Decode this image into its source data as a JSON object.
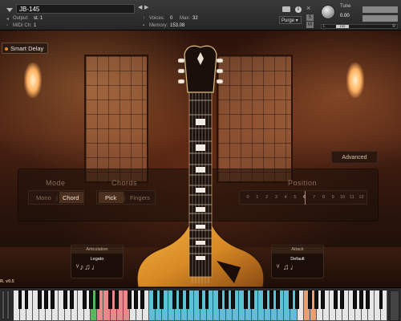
{
  "header": {
    "instrument_name": "JB-145",
    "output_label": "Output:",
    "output_value": "st. 1",
    "midi_label": "MIDI Ch:",
    "midi_value": "1",
    "voices_label": "Voices:",
    "voices_value": "0",
    "max_label": "Max:",
    "max_value": "32",
    "memory_label": "Memory:",
    "memory_value": "153.08",
    "purge_label": "Purge",
    "info_label": "i",
    "close_label": "×",
    "solo_label": "S",
    "mute_label": "M",
    "tune_label": "Tune",
    "tune_value": "0.00",
    "pan_left": "L",
    "pan_value": "100",
    "pan_right": "R"
  },
  "panel": {
    "smart_delay_label": "Smart Delay",
    "advanced_label": "Advanced",
    "mode": {
      "title": "Mode",
      "options": [
        "Mono",
        "Chord"
      ],
      "divider": "|",
      "selected": "Chord"
    },
    "chords": {
      "title": "Chords",
      "options": [
        "Pick",
        "Fingers"
      ],
      "divider": "|",
      "selected": "Pick"
    },
    "position": {
      "title": "Position",
      "numbers": [
        "0",
        "1",
        "2",
        "3",
        "4",
        "5",
        "6",
        "7",
        "8",
        "9",
        "10",
        "11",
        "12"
      ],
      "selected": "6"
    },
    "articulation": {
      "title": "Articulation",
      "value": "Legato"
    },
    "attack": {
      "title": "Attack",
      "value": "Default"
    },
    "version": "R. v0.5"
  },
  "keyboard": {
    "colors": {
      "white": "#e6e6e6",
      "green": "#56b85a",
      "red": "#e88a8a",
      "blue": "#5fbfd8",
      "orange": "#e8a070"
    }
  }
}
